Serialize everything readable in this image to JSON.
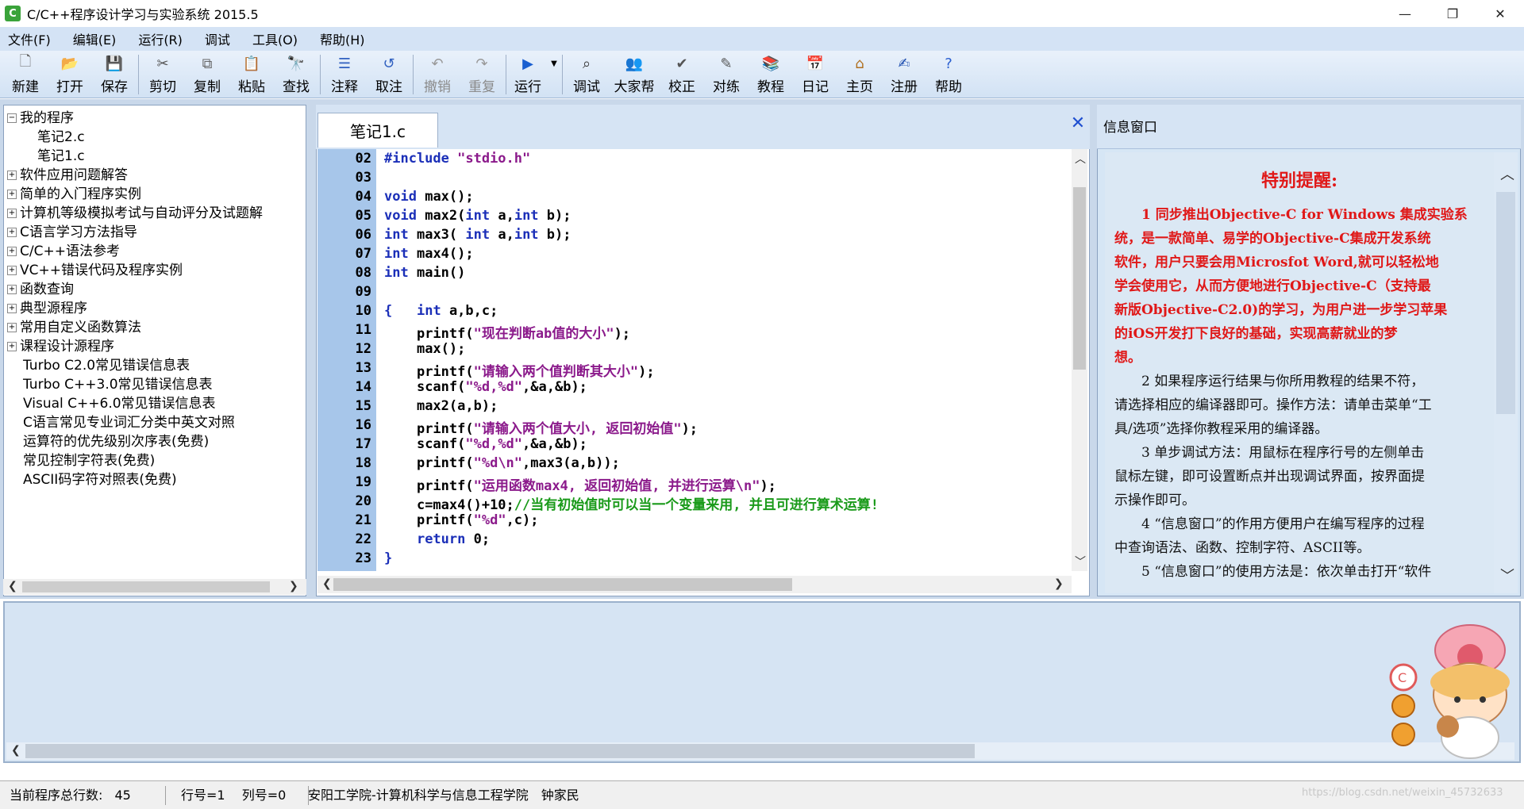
{
  "window": {
    "title": "C/C++程序设计学习与实验系统 2015.5",
    "icon_letter": "C",
    "controls": {
      "minimize": "—",
      "maximize": "❐",
      "close": "✕"
    }
  },
  "menu": [
    "文件(F)",
    "编辑(E)",
    "运行(R)",
    "调试",
    "工具(O)",
    "帮助(H)"
  ],
  "toolbar": {
    "new": "新建",
    "open": "打开",
    "save": "保存",
    "cut": "剪切",
    "copy": "复制",
    "paste": "粘贴",
    "find": "查找",
    "comment": "注释",
    "uncomment": "取注",
    "undo": "撤销",
    "redo": "重复",
    "run": "运行",
    "debug": "调试",
    "community": "大家帮",
    "check": "校正",
    "practice": "对练",
    "tutorial": "教程",
    "diary": "日记",
    "home": "主页",
    "register": "注册",
    "help": "帮助"
  },
  "tree": {
    "root": "我的程序",
    "files": [
      "笔记2.c",
      "笔记1.c"
    ],
    "categories": [
      "软件应用问题解答",
      "简单的入门程序实例",
      "计算机等级模拟考试与自动评分及试题解",
      "C语言学习方法指导",
      "C/C++语法参考",
      "VC++错误代码及程序实例",
      "函数查询",
      "典型源程序",
      "常用自定义函数算法",
      "课程设计源程序"
    ],
    "leaves": [
      "Turbo C2.0常见错误信息表",
      "Turbo C++3.0常见错误信息表",
      "Visual C++6.0常见错误信息表",
      "C语言常见专业词汇分类中英文对照",
      "运算符的优先级别次序表(免费)",
      "常见控制字符表(免费)",
      "ASCII码字符对照表(免费)"
    ]
  },
  "editor": {
    "tab": "笔记1.c",
    "line_numbers": [
      "02",
      "03",
      "04",
      "05",
      "06",
      "07",
      "08",
      "09",
      "10",
      "11",
      "12",
      "13",
      "14",
      "15",
      "16",
      "17",
      "18",
      "19",
      "20",
      "21",
      "22",
      "23"
    ],
    "code": {
      "l02a": "#include ",
      "l02b": "\"stdio.h\"",
      "l04": "max();",
      "l05": "max2(",
      "l05b": " a,",
      "l05c": " b);",
      "l06": "max3( ",
      "l06b": " a,",
      "l06c": " b);",
      "l07": "max4();",
      "l08": "main()",
      "l10": "a,b,c;",
      "l11a": "printf(",
      "l11b": "\"现在判断ab值的大小\"",
      "l11c": ");",
      "l12": "max();",
      "l13a": "printf(",
      "l13b": "\"请输入两个值判断其大小\"",
      "l13c": ");",
      "l14a": "scanf(",
      "l14b": "\"%d,%d\"",
      "l14c": ",&a,&b);",
      "l15": "max2(a,b);",
      "l16a": "printf(",
      "l16b": "\"请输入两个值大小, 返回初始值\"",
      "l16c": ");",
      "l17a": "scanf(",
      "l17b": "\"%d,%d\"",
      "l17c": ",&a,&b);",
      "l18a": "printf(",
      "l18b": "\"%d\\n\"",
      "l18c": ",max3(a,b));",
      "l19a": "printf(",
      "l19b": "\"运用函数max4, 返回初始值, 并进行运算\\n\"",
      "l19c": ");",
      "l20a": "c=max4()+10;",
      "l20b": "//当有初始值时可以当一个变量来用, 并且可进行算术运算!",
      "l21a": "printf(",
      "l21b": "\"%d\"",
      "l21c": ",c);",
      "l22a": "return",
      "l22b": " 0;",
      "brace_open": "{",
      "brace_close": "}",
      "kw_void": "void",
      "kw_int": "int"
    }
  },
  "info": {
    "title": "信息窗口",
    "heading": "特别提醒:",
    "red_lines": [
      "　　1 同步推出Objective-C for Windows 集成实验系",
      "统，是一款简单、易学的Objective-C集成开发系统",
      "软件，用户只要会用Microsfot Word,就可以轻松地",
      "学会使用它，从而方便地进行Objective-C（支持最",
      "新版Objective-C2.0)的学习，为用户进一步学习苹果",
      "的iOS开发打下良好的基础，实现高薪就业的梦",
      "想。"
    ],
    "black_lines": [
      "　　2 如果程序运行结果与你所用教程的结果不符，",
      "请选择相应的编译器即可。操作方法：请单击菜单“工",
      "具/选项”选择你教程采用的编译器。",
      "　　3 单步调试方法：用鼠标在程序行号的左侧单击",
      "鼠标左键，即可设置断点并出现调试界面，按界面提",
      "示操作即可。",
      "　　4 “信息窗口”的作用方便用户在编写程序的过程",
      "中查询语法、函数、控制字符、ASCII等。",
      "　　5 “信息窗口”的使用方法是：依次单击打开“软件"
    ]
  },
  "status": {
    "total_lines_label": "当前程序总行数:",
    "total_lines": "45",
    "row": "行号=1",
    "col": "列号=0",
    "author": "安阳工学院-计算机科学与信息工程学院　钟家民"
  },
  "watermark": "https://blog.csdn.net/weixin_45732633"
}
